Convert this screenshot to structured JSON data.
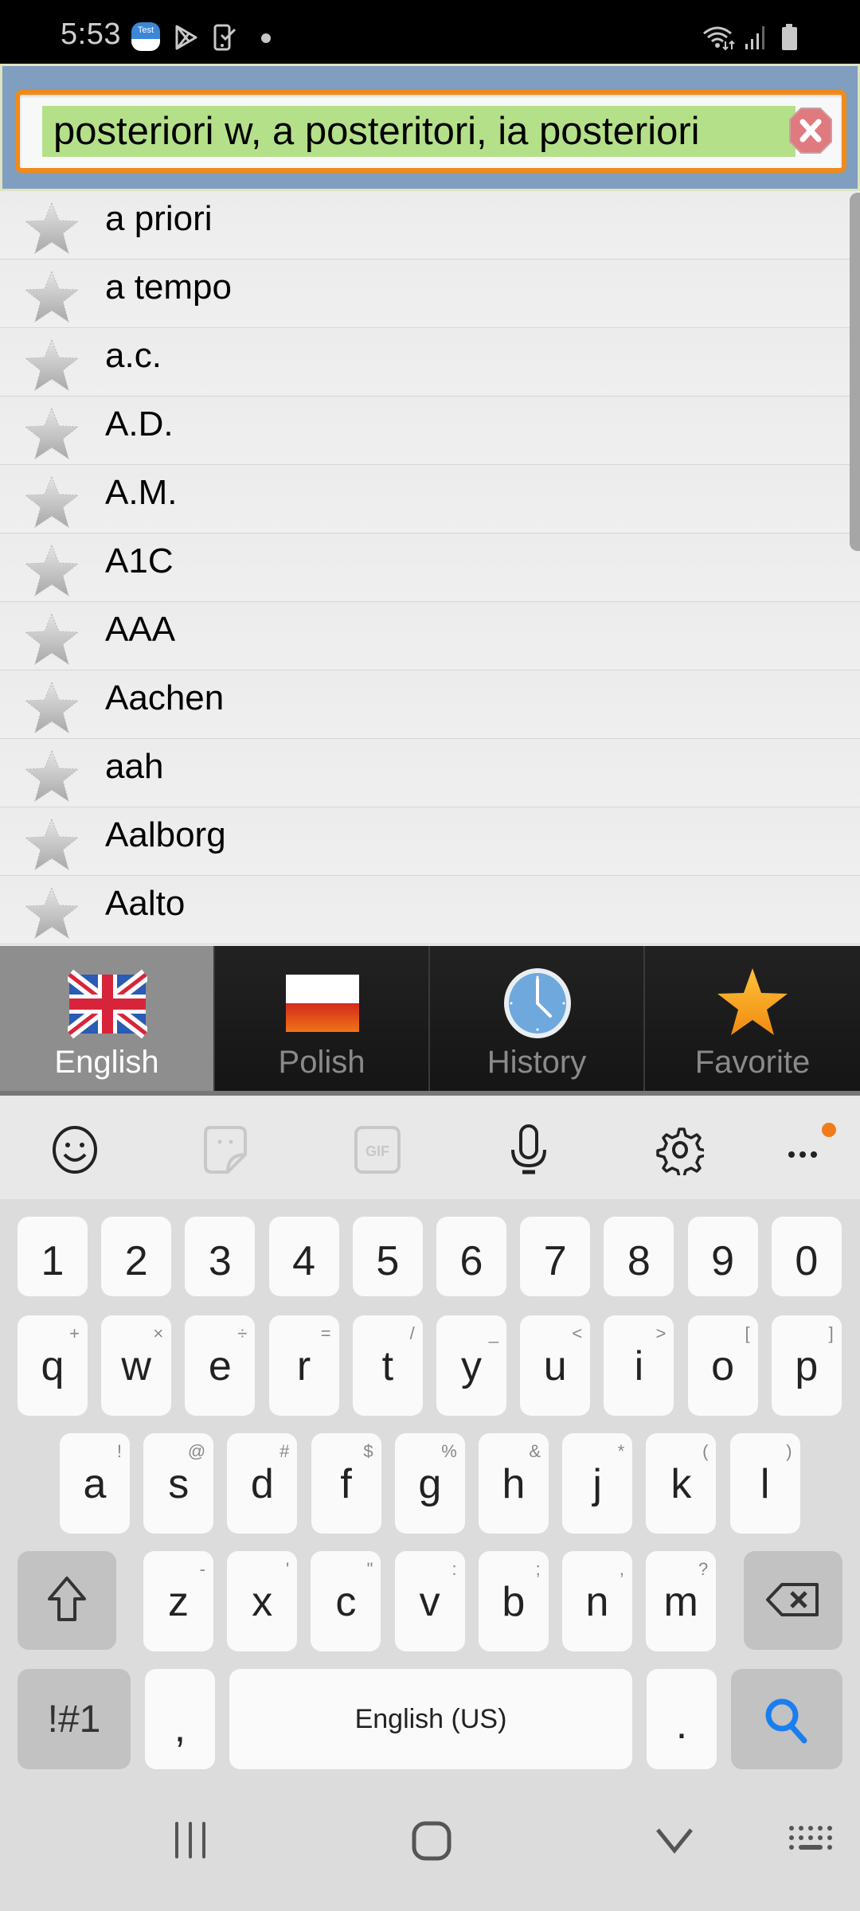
{
  "status_bar": {
    "time": "5:53",
    "notification_icons": [
      "test-app-icon",
      "play-store-icon",
      "device-check-icon",
      "more-notifications-dot"
    ],
    "system_icons": [
      "wifi-icon",
      "signal-icon",
      "battery-icon"
    ],
    "test_app_label": "Test"
  },
  "search": {
    "value": "posteriori w, a posteritori, ia posteriori",
    "clear_icon": "clear-icon"
  },
  "word_list": {
    "items": [
      {
        "word": "a priori",
        "favorite": false
      },
      {
        "word": "a tempo",
        "favorite": false
      },
      {
        "word": "a.c.",
        "favorite": false
      },
      {
        "word": "A.D.",
        "favorite": false
      },
      {
        "word": "A.M.",
        "favorite": false
      },
      {
        "word": "A1C",
        "favorite": false
      },
      {
        "word": "AAA",
        "favorite": false
      },
      {
        "word": "Aachen",
        "favorite": false
      },
      {
        "word": "aah",
        "favorite": false
      },
      {
        "word": "Aalborg",
        "favorite": false
      },
      {
        "word": "Aalto",
        "favorite": false
      }
    ]
  },
  "tabs": [
    {
      "label": "English",
      "icon": "uk-flag-icon",
      "active": true
    },
    {
      "label": "Polish",
      "icon": "poland-flag-icon",
      "active": false
    },
    {
      "label": "History",
      "icon": "clock-icon",
      "active": false
    },
    {
      "label": "Favorite",
      "icon": "star-icon",
      "active": false
    }
  ],
  "keyboard_toolbar": {
    "items": [
      "emoji-icon",
      "sticker-icon",
      "gif-icon",
      "microphone-icon",
      "settings-icon",
      "more-icon"
    ],
    "gif_label": "GIF",
    "accent_dot_color": "#f07b18"
  },
  "keyboard": {
    "number_row": [
      "1",
      "2",
      "3",
      "4",
      "5",
      "6",
      "7",
      "8",
      "9",
      "0"
    ],
    "row1": [
      {
        "key": "q",
        "alt": "+"
      },
      {
        "key": "w",
        "alt": "×"
      },
      {
        "key": "e",
        "alt": "÷"
      },
      {
        "key": "r",
        "alt": "="
      },
      {
        "key": "t",
        "alt": "/"
      },
      {
        "key": "y",
        "alt": "_"
      },
      {
        "key": "u",
        "alt": "<"
      },
      {
        "key": "i",
        "alt": ">"
      },
      {
        "key": "o",
        "alt": "["
      },
      {
        "key": "p",
        "alt": "]"
      }
    ],
    "row2": [
      {
        "key": "a",
        "alt": "!"
      },
      {
        "key": "s",
        "alt": "@"
      },
      {
        "key": "d",
        "alt": "#"
      },
      {
        "key": "f",
        "alt": "$"
      },
      {
        "key": "g",
        "alt": "%"
      },
      {
        "key": "h",
        "alt": "&"
      },
      {
        "key": "j",
        "alt": "*"
      },
      {
        "key": "k",
        "alt": "("
      },
      {
        "key": "l",
        "alt": ")"
      }
    ],
    "row3": [
      {
        "key": "z",
        "alt": "-"
      },
      {
        "key": "x",
        "alt": "'"
      },
      {
        "key": "c",
        "alt": "\""
      },
      {
        "key": "v",
        "alt": ":"
      },
      {
        "key": "b",
        "alt": ";"
      },
      {
        "key": "n",
        "alt": ","
      },
      {
        "key": "m",
        "alt": "?"
      }
    ],
    "symbols_label": "!#1",
    "comma_label": ",",
    "space_label": "English (US)",
    "period_label": ".",
    "action_icon": "search-icon",
    "action_color": "#1a7ef0"
  },
  "nav_bar": {
    "buttons": [
      "recent-apps-icon",
      "home-icon",
      "back-icon",
      "keyboard-switch-icon"
    ]
  }
}
